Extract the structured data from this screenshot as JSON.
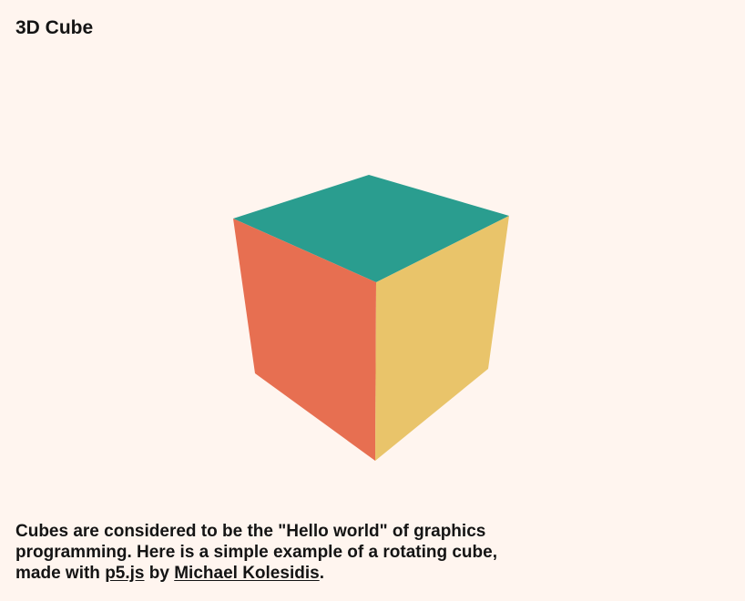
{
  "page": {
    "title": "3D Cube"
  },
  "cube": {
    "faces": {
      "top_color": "#2a9d8f",
      "left_color": "#e76f51",
      "right_color": "#e9c46a"
    }
  },
  "description": {
    "text_before": "Cubes are considered to be the \"Hello world\" of graphics programming. Here is a simple example of a rotating cube, made with ",
    "link_p5": "p5.js",
    "text_by": " by ",
    "link_author": "Michael Kolesidis",
    "text_after": "."
  }
}
